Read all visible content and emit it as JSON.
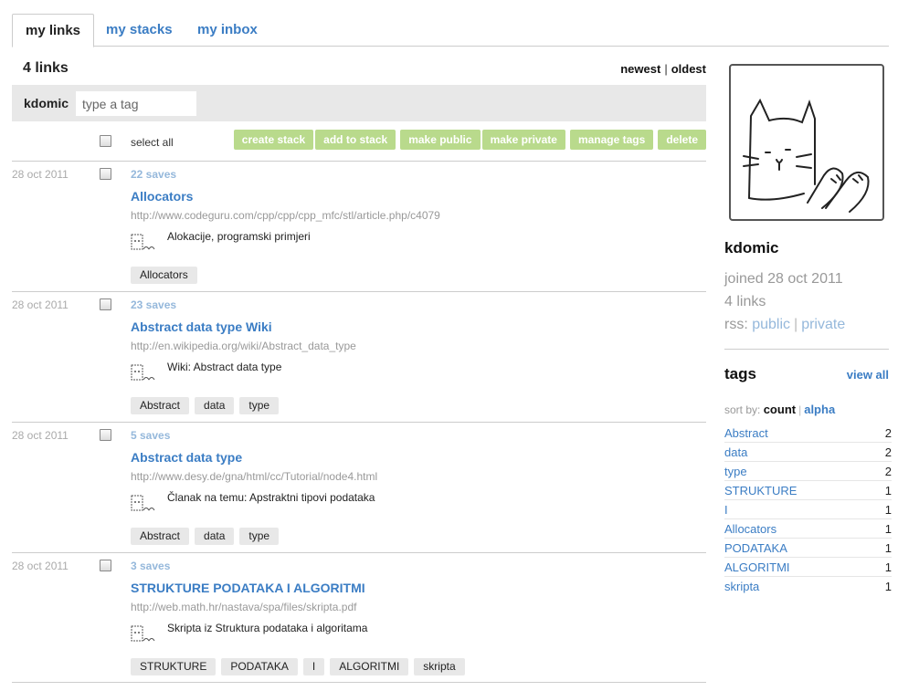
{
  "tabs": [
    {
      "label": "my links",
      "active": true
    },
    {
      "label": "my stacks",
      "active": false
    },
    {
      "label": "my inbox",
      "active": false
    }
  ],
  "main": {
    "link_count": "4 links",
    "sort_newest": "newest",
    "sort_oldest": "oldest",
    "filter_user": "kdomic",
    "tag_placeholder": "type a tag",
    "select_all": "select all",
    "buttons": [
      "create stack",
      "add to stack",
      "make public",
      "make private",
      "manage tags",
      "delete"
    ],
    "links": [
      {
        "date": "28 oct 2011",
        "saves": "22 saves",
        "title": "Allocators",
        "url": "http://www.codeguru.com/cpp/cpp/cpp_mfc/stl/article.php/c4079",
        "note": "Alokacije, programski primjeri",
        "tags": [
          "Allocators"
        ]
      },
      {
        "date": "28 oct 2011",
        "saves": "23 saves",
        "title": "Abstract data type Wiki",
        "url": "http://en.wikipedia.org/wiki/Abstract_data_type",
        "note": "Wiki: Abstract data type",
        "tags": [
          "Abstract",
          "data",
          "type"
        ]
      },
      {
        "date": "28 oct 2011",
        "saves": "5 saves",
        "title": "Abstract data type",
        "url": "http://www.desy.de/gna/html/cc/Tutorial/node4.html",
        "note": "Članak na temu: Apstraktni tipovi podataka",
        "tags": [
          "Abstract",
          "data",
          "type"
        ]
      },
      {
        "date": "28 oct 2011",
        "saves": "3 saves",
        "title": "STRUKTURE PODATAKA I ALGORITMI",
        "url": "http://web.math.hr/nastava/spa/files/skripta.pdf",
        "note": "Skripta iz Struktura podataka i algoritama",
        "tags": [
          "STRUKTURE",
          "PODATAKA",
          "I",
          "ALGORITMI",
          "skripta"
        ]
      }
    ]
  },
  "sidebar": {
    "username": "kdomic",
    "joined": "joined 28 oct 2011",
    "links": "4 links",
    "rss_label": "rss:",
    "rss_public": "public",
    "rss_private": "private",
    "tags_heading": "tags",
    "view_all": "view all",
    "sort_by_label": "sort by:",
    "sort_count": "count",
    "sort_alpha": "alpha",
    "tag_list": [
      {
        "name": "Abstract",
        "count": "2"
      },
      {
        "name": "data",
        "count": "2"
      },
      {
        "name": "type",
        "count": "2"
      },
      {
        "name": "STRUKTURE",
        "count": "1"
      },
      {
        "name": "I",
        "count": "1"
      },
      {
        "name": "Allocators",
        "count": "1"
      },
      {
        "name": "PODATAKA",
        "count": "1"
      },
      {
        "name": "ALGORITMI",
        "count": "1"
      },
      {
        "name": "skripta",
        "count": "1"
      }
    ]
  },
  "colors": {
    "link_blue": "#3b7dc4",
    "button_green": "#b9da8c",
    "saves_blue": "#95b8db"
  }
}
